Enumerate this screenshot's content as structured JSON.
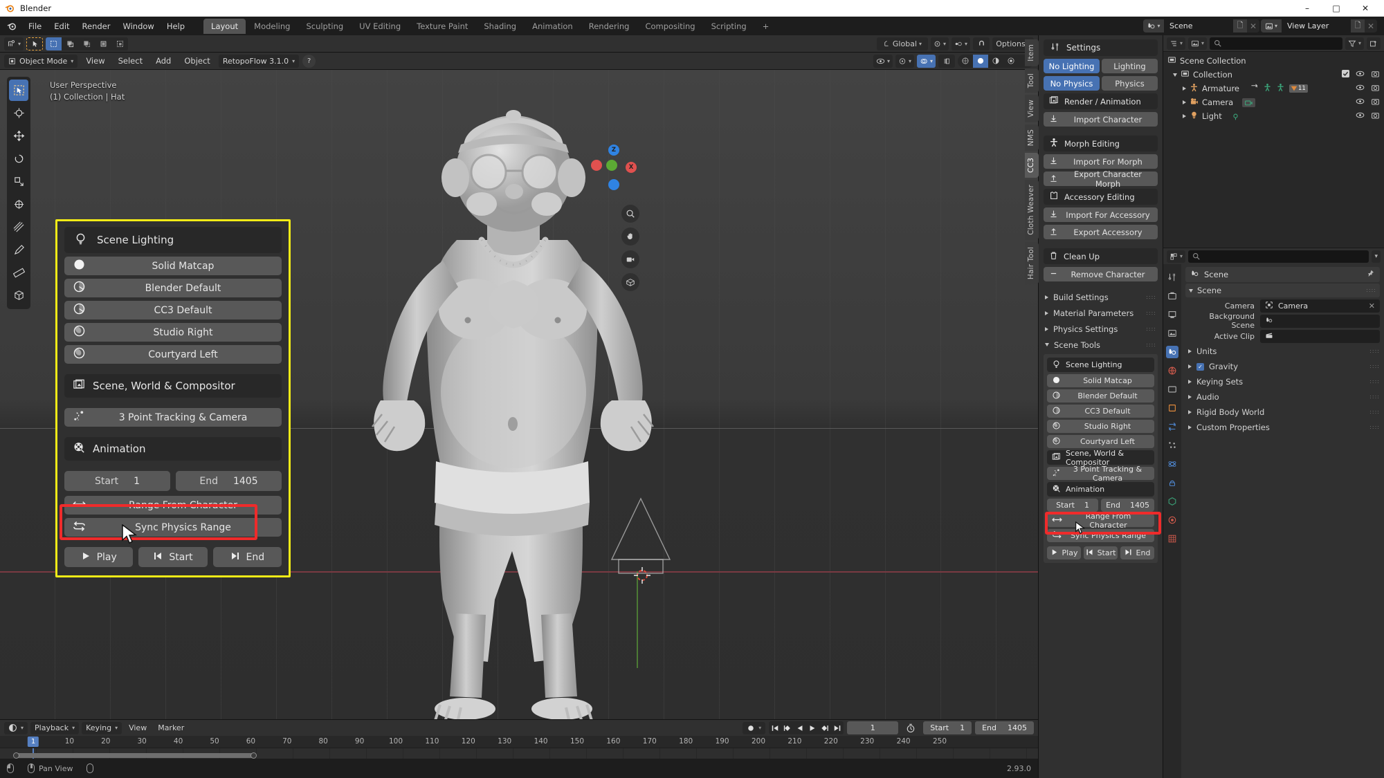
{
  "window": {
    "title": "Blender",
    "minimize": "–",
    "maximize": "□",
    "close": "✕"
  },
  "topbar": {
    "menus": [
      "File",
      "Edit",
      "Render",
      "Window",
      "Help"
    ],
    "workspace_tabs": [
      "Layout",
      "Modeling",
      "Sculpting",
      "UV Editing",
      "Texture Paint",
      "Shading",
      "Animation",
      "Rendering",
      "Compositing",
      "Scripting",
      "+"
    ],
    "active_workspace": "Layout",
    "scene_name": "Scene",
    "view_layer_name": "View Layer"
  },
  "tool_header": {
    "transform_orientation": "Global",
    "options_label": "Options"
  },
  "viewport_header": {
    "mode": "Object Mode",
    "menus": [
      "View",
      "Select",
      "Add",
      "Object"
    ],
    "addon": "RetopoFlow 3.1.0",
    "help_glyph": "?"
  },
  "viewport": {
    "perspective": "User Perspective",
    "collection_info": "(1) Collection | Hat",
    "gizmo_axes": [
      "Z",
      "X"
    ],
    "scene_tools_strip": "Scene Tools"
  },
  "npanel": {
    "scene_lighting_header": "Scene Lighting",
    "matcaps": [
      {
        "label": "Solid Matcap",
        "icon": "sphere-white-icon"
      },
      {
        "label": "Blender Default",
        "icon": "sphere-half-icon"
      },
      {
        "label": "CC3 Default",
        "icon": "sphere-half-icon"
      },
      {
        "label": "Studio Right",
        "icon": "sphere-shaded-icon"
      },
      {
        "label": "Courtyard Left",
        "icon": "sphere-shaded-icon"
      }
    ],
    "scene_world_compositor": "Scene, World & Compositor",
    "three_point_tracking": "3 Point Tracking & Camera",
    "animation_header": "Animation",
    "frame_start_label": "Start",
    "frame_start_value": "1",
    "frame_end_label": "End",
    "frame_end_value": "1405",
    "range_from_character": "Range From Character",
    "sync_physics_range": "Sync Physics Range",
    "play_label": "Play",
    "jump_start_label": "Start",
    "jump_end_label": "End"
  },
  "sidebar": {
    "vertical_tabs": [
      "Item",
      "Tool",
      "View",
      "NMS",
      "CC3",
      "Cloth Weaver",
      "Hair Tool"
    ],
    "active_vertical_tab": "CC3",
    "settings_header": "Settings",
    "lighting_toggle": {
      "off": "No Lighting",
      "on": "Lighting",
      "active": "No Lighting"
    },
    "physics_toggle": {
      "off": "No Physics",
      "on": "Physics",
      "active": "No Physics"
    },
    "render_animation": "Render / Animation",
    "import_character": "Import Character",
    "morph_editing": "Morph Editing",
    "import_for_morph": "Import For Morph",
    "export_character_morph": "Export Character Morph",
    "accessory_editing": "Accessory Editing",
    "import_for_accessory": "Import For Accessory",
    "export_accessory": "Export Accessory",
    "clean_up": "Clean Up",
    "remove_character": "Remove Character",
    "collapsibles": [
      {
        "label": "Build Settings",
        "open": false
      },
      {
        "label": "Material Parameters",
        "open": false
      },
      {
        "label": "Physics Settings",
        "open": false
      },
      {
        "label": "Scene Tools",
        "open": true
      }
    ],
    "scene_tools": {
      "scene_lighting": "Scene Lighting",
      "matcaps": [
        "Solid Matcap",
        "Blender Default",
        "CC3 Default",
        "Studio Right",
        "Courtyard Left"
      ],
      "scene_world_compositor": "Scene, World & Compositor",
      "three_point_tracking": "3 Point Tracking & Camera",
      "animation": "Animation",
      "start_label": "Start",
      "start_value": "1",
      "end_label": "End",
      "end_value": "1405",
      "range_from_character": "Range From Character",
      "sync_physics_range": "Sync Physics Range",
      "play": "Play",
      "jump_start": "Start",
      "jump_end": "End"
    }
  },
  "outliner": {
    "search_placeholder": "",
    "rows": [
      {
        "label": "Scene Collection",
        "indent": 0,
        "icon": "collection-icon",
        "expand": null
      },
      {
        "label": "Collection",
        "indent": 1,
        "icon": "collection-icon",
        "expand": "open",
        "checkbox": true
      },
      {
        "label": "Armature",
        "indent": 2,
        "icon": "armature-icon",
        "expand": "closed",
        "badge": "11"
      },
      {
        "label": "Camera",
        "indent": 2,
        "icon": "camera-icon",
        "expand": "closed"
      },
      {
        "label": "Light",
        "indent": 2,
        "icon": "light-icon",
        "expand": "closed"
      }
    ]
  },
  "properties": {
    "breadcrumb_label": "Scene",
    "section_scene": "Scene",
    "fields": [
      {
        "label": "Camera",
        "value": "Camera",
        "icon": "camera-data-icon",
        "clearable": true
      },
      {
        "label": "Background Scene",
        "value": "",
        "icon": "scene-icon",
        "clearable": false
      },
      {
        "label": "Active Clip",
        "value": "",
        "icon": "clip-icon",
        "clearable": false
      }
    ],
    "collapsibles": [
      {
        "label": "Units",
        "checkbox": false
      },
      {
        "label": "Gravity",
        "checkbox": true
      },
      {
        "label": "Keying Sets",
        "checkbox": false
      },
      {
        "label": "Audio",
        "checkbox": false
      },
      {
        "label": "Rigid Body World",
        "checkbox": false
      },
      {
        "label": "Custom Properties",
        "checkbox": false
      }
    ]
  },
  "timeline": {
    "menus": [
      "Playback",
      "Keying",
      "View",
      "Marker"
    ],
    "ruler_ticks": [
      "10",
      "20",
      "30",
      "40",
      "50",
      "60",
      "70",
      "80",
      "90",
      "100",
      "110",
      "120",
      "130",
      "140",
      "150",
      "160",
      "170",
      "180",
      "190",
      "200",
      "210",
      "220",
      "230",
      "240",
      "250"
    ],
    "current_frame": "1",
    "start_label": "Start",
    "start_value": "1",
    "end_label": "End",
    "end_value": "1405"
  },
  "statusbar": {
    "pan_view": "Pan View",
    "version": "2.93.0"
  },
  "colors": {
    "accent_blue": "#4772b3",
    "highlight_yellow": "#f2eb16",
    "highlight_red": "#ef2b2b",
    "panel_bg": "#303030",
    "button_gray": "#585858"
  }
}
